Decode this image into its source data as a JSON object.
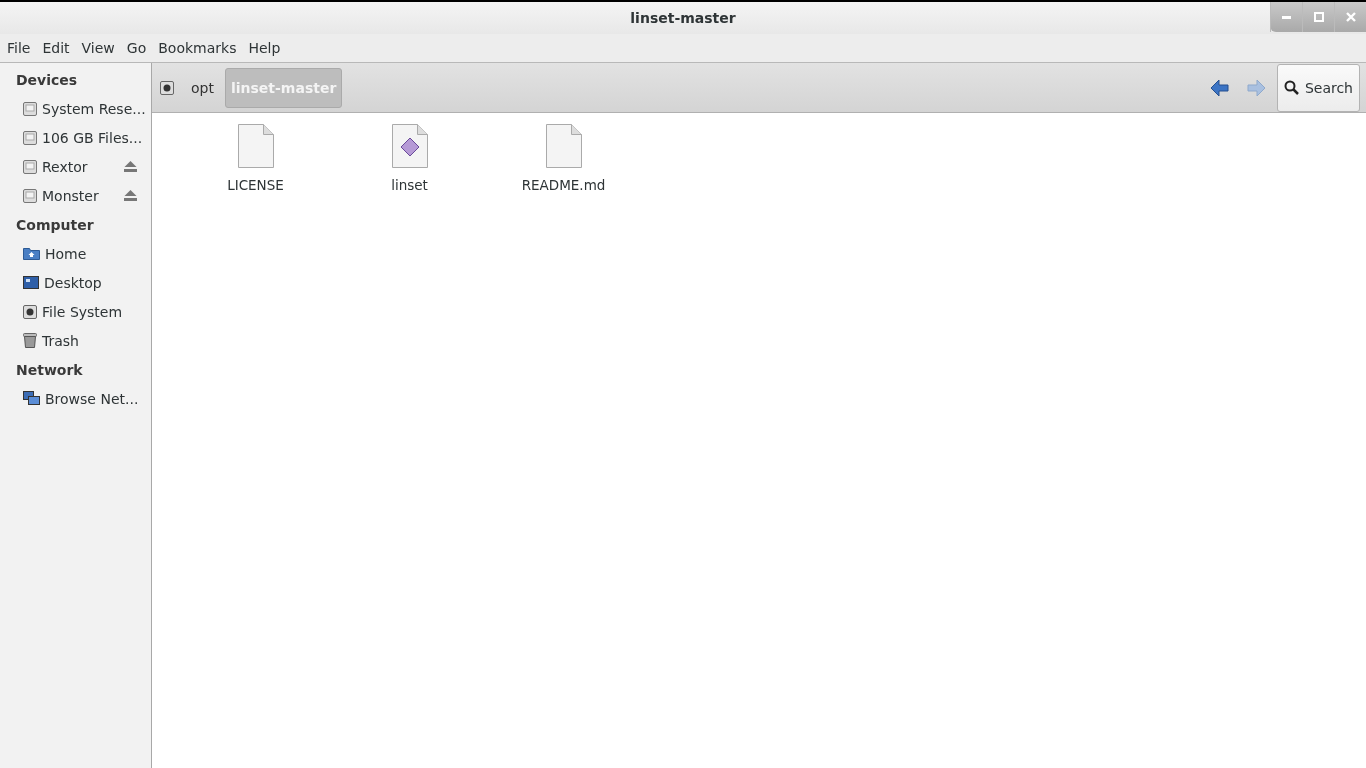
{
  "window": {
    "title": "linset-master"
  },
  "menu": [
    "File",
    "Edit",
    "View",
    "Go",
    "Bookmarks",
    "Help"
  ],
  "sidebar": {
    "sections": [
      {
        "title": "Devices",
        "items": [
          {
            "label": "System Rese...",
            "kind": "drive",
            "eject": false
          },
          {
            "label": "106 GB Files...",
            "kind": "drive",
            "eject": false
          },
          {
            "label": "Rextor",
            "kind": "drive",
            "eject": true
          },
          {
            "label": "Monster",
            "kind": "drive",
            "eject": true
          }
        ]
      },
      {
        "title": "Computer",
        "items": [
          {
            "label": "Home",
            "kind": "home",
            "eject": false
          },
          {
            "label": "Desktop",
            "kind": "desktop",
            "eject": false
          },
          {
            "label": "File System",
            "kind": "filesystem",
            "eject": false
          },
          {
            "label": "Trash",
            "kind": "trash",
            "eject": false
          }
        ]
      },
      {
        "title": "Network",
        "items": [
          {
            "label": "Browse Net...",
            "kind": "network",
            "eject": false
          }
        ]
      }
    ]
  },
  "toolbar": {
    "path": [
      {
        "label": "opt",
        "selected": false
      },
      {
        "label": "linset-master",
        "selected": true
      }
    ],
    "back": {
      "disabled": false
    },
    "forward": {
      "disabled": true
    },
    "search": "Search"
  },
  "files": [
    {
      "name": "LICENSE",
      "kind": "text"
    },
    {
      "name": "linset",
      "kind": "script"
    },
    {
      "name": "README.md",
      "kind": "text"
    }
  ]
}
